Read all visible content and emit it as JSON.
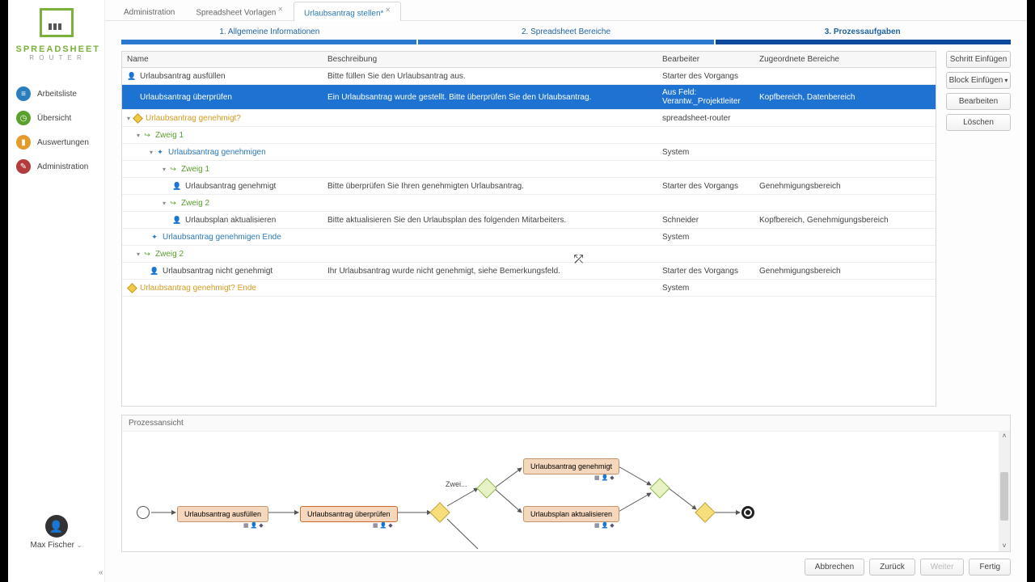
{
  "brand": {
    "line1": "SPREADSHEET",
    "line2": "R O U T E R"
  },
  "nav": {
    "arbeitsliste": "Arbeitsliste",
    "ubersicht": "Übersicht",
    "auswertungen": "Auswertungen",
    "administration": "Administration"
  },
  "user": {
    "name": "Max Fischer"
  },
  "tabs": {
    "administration": "Administration",
    "vorlagen": "Spreadsheet Vorlagen",
    "urlaubsantrag": "Urlaubsantrag stellen*"
  },
  "steps": {
    "s1": "1. Allgemeine Informationen",
    "s2": "2. Spreadsheet Bereiche",
    "s3": "3. Prozessaufgaben"
  },
  "columns": {
    "name": "Name",
    "beschreibung": "Beschreibung",
    "bearbeiter": "Bearbeiter",
    "zugeordnete": "Zugeordnete Bereiche"
  },
  "rows": {
    "r0": {
      "name": "Urlaubsantrag ausfüllen",
      "desc": "Bitte füllen Sie den Urlaubsantrag aus.",
      "bear": "Starter des Vorgangs",
      "zug": ""
    },
    "r1": {
      "name": "Urlaubsantrag überprüfen",
      "desc": "Ein Urlaubsantrag wurde gestellt. Bitte überprüfen Sie den Urlaubsantrag.",
      "bear": "Aus Feld: Verantw._Projektleiter",
      "zug": "Kopfbereich, Datenbereich"
    },
    "r2": {
      "name": "Urlaubsantrag genehmigt?",
      "desc": "",
      "bear": "spreadsheet-router",
      "zug": ""
    },
    "r3": {
      "name": "Zweig 1",
      "desc": "",
      "bear": "",
      "zug": ""
    },
    "r4": {
      "name": "Urlaubsantrag genehmigen",
      "desc": "",
      "bear": "System",
      "zug": ""
    },
    "r5": {
      "name": "Zweig 1",
      "desc": "",
      "bear": "",
      "zug": ""
    },
    "r6": {
      "name": "Urlaubsantrag genehmigt",
      "desc": "Bitte überprüfen Sie Ihren genehmigten Urlaubsantrag.",
      "bear": "Starter des Vorgangs",
      "zug": "Genehmigungsbereich"
    },
    "r7": {
      "name": "Zweig 2",
      "desc": "",
      "bear": "",
      "zug": ""
    },
    "r8": {
      "name": "Urlaubsplan aktualisieren",
      "desc": "Bitte aktualisieren Sie den Urlaubsplan des folgenden Mitarbeiters.",
      "bear": "Schneider",
      "zug": "Kopfbereich, Genehmigungsbereich"
    },
    "r9": {
      "name": "Urlaubsantrag genehmigen Ende",
      "desc": "",
      "bear": "System",
      "zug": ""
    },
    "r10": {
      "name": "Zweig 2",
      "desc": "",
      "bear": "",
      "zug": ""
    },
    "r11": {
      "name": "Urlaubsantrag nicht genehmigt",
      "desc": "Ihr Urlaubsantrag wurde nicht genehmigt, siehe Bemerkungsfeld.",
      "bear": "Starter des Vorgangs",
      "zug": "Genehmigungsbereich"
    },
    "r12": {
      "name": "Urlaubsantrag genehmigt? Ende",
      "desc": "",
      "bear": "System",
      "zug": ""
    }
  },
  "side_buttons": {
    "schritt": "Schritt Einfügen",
    "block": "Block Einfügen",
    "bearbeiten": "Bearbeiten",
    "loeschen": "Löschen"
  },
  "process": {
    "title": "Prozessansicht",
    "zwei_label": "Zwei...",
    "n1": "Urlaubsantrag ausfüllen",
    "n2": "Urlaubsantrag überprüfen",
    "n3": "Urlaubsantrag genehmigt",
    "n4": "Urlaubsplan aktualisieren"
  },
  "footer": {
    "abbrechen": "Abbrechen",
    "zurueck": "Zurück",
    "weiter": "Weiter",
    "fertig": "Fertig"
  }
}
